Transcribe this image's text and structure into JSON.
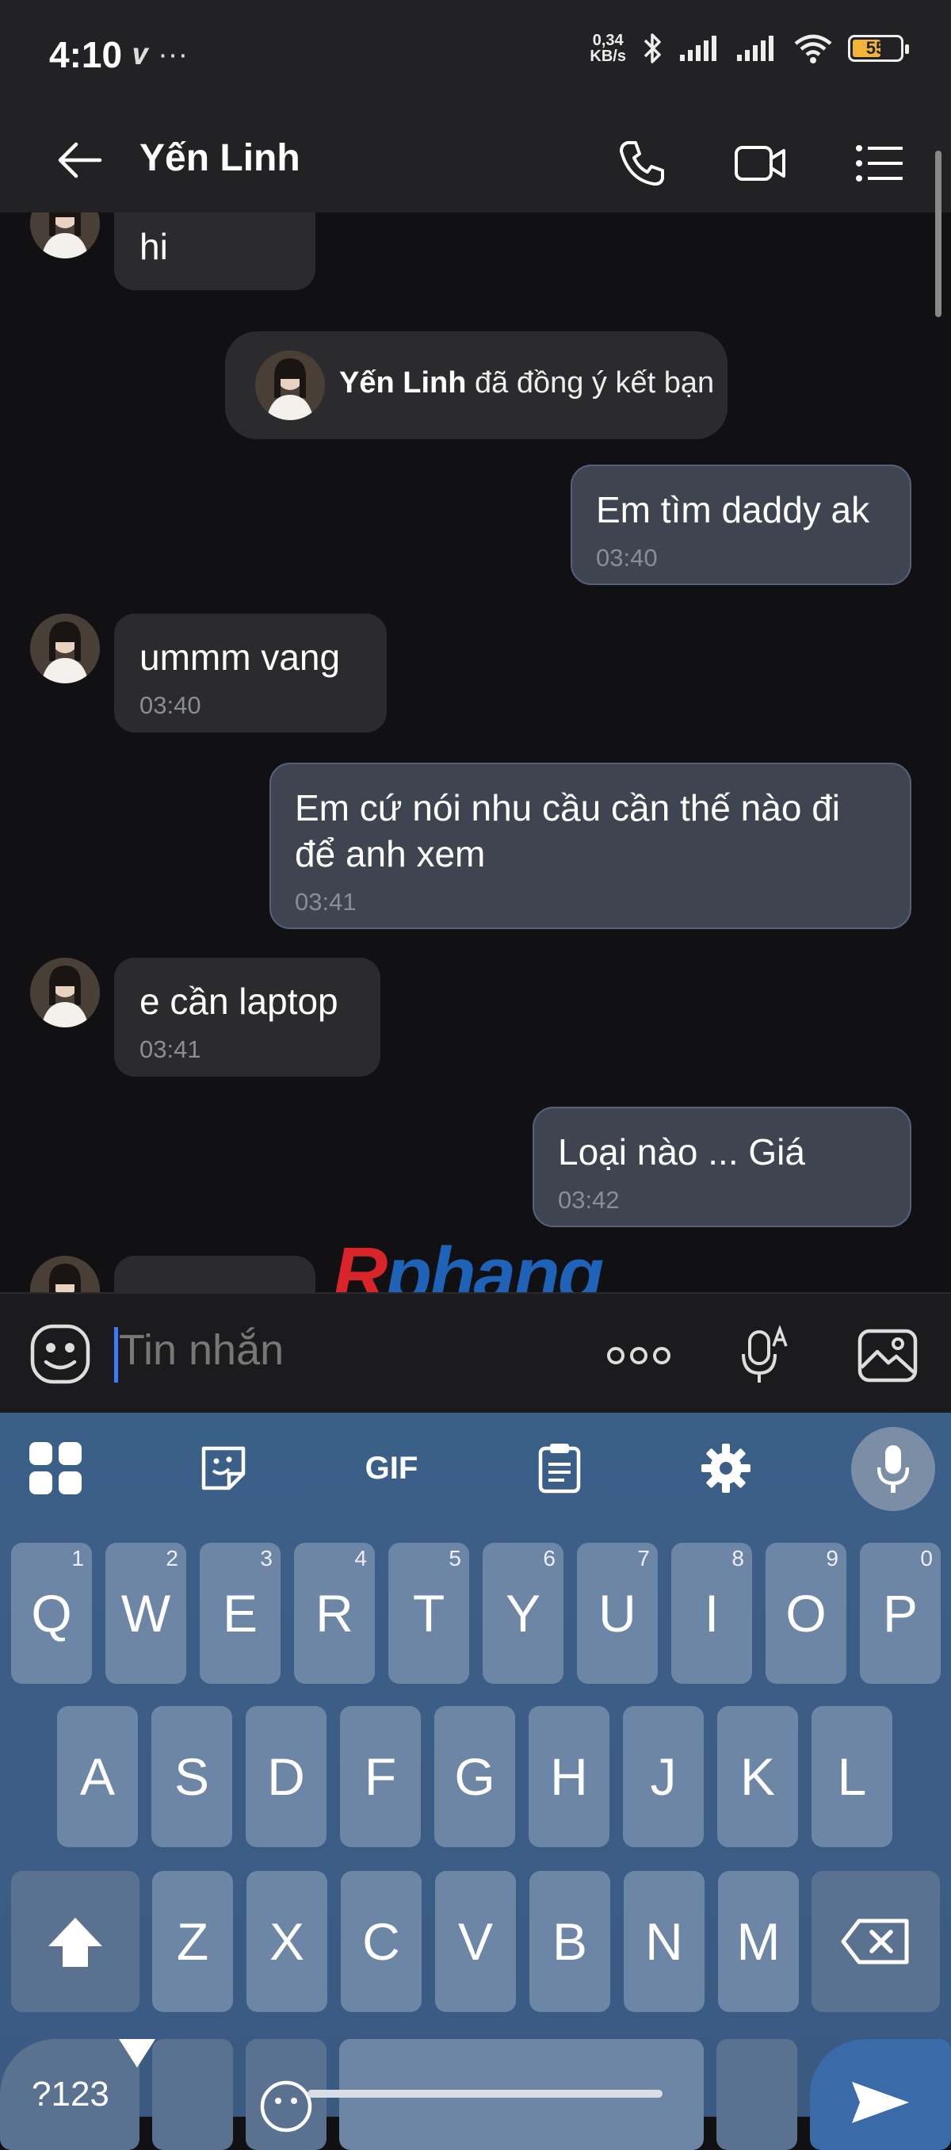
{
  "status_bar": {
    "time": "4:10",
    "net_speed_value": "0,34",
    "net_speed_unit": "KB/s",
    "battery": "55",
    "left_icons": "𝒗 ···"
  },
  "header": {
    "title": "Yến Linh"
  },
  "messages": {
    "msg1": {
      "text": "hi"
    },
    "system": {
      "name": "Yến Linh",
      "action": " đã đồng ý kết bạn"
    },
    "msg2": {
      "text": "Em tìm daddy ak",
      "time": "03:40"
    },
    "msg3": {
      "text": "ummm vang",
      "time": "03:40"
    },
    "msg4": {
      "line1": "Em cứ nói nhu cầu cần thế nào đi",
      "line2": "để anh xem",
      "time": "03:41"
    },
    "msg5": {
      "text": "e cần laptop",
      "time": "03:41"
    },
    "msg6": {
      "text": "Loại nào ... Giá",
      "time": "03:42"
    }
  },
  "watermark": {
    "part1": "R",
    "part2": "phang"
  },
  "input": {
    "placeholder": "Tin nhắn"
  },
  "keyboard": {
    "gif_label": "GIF",
    "row1": [
      {
        "k": "Q",
        "h": "1"
      },
      {
        "k": "W",
        "h": "2"
      },
      {
        "k": "E",
        "h": "3"
      },
      {
        "k": "R",
        "h": "4"
      },
      {
        "k": "T",
        "h": "5"
      },
      {
        "k": "Y",
        "h": "6"
      },
      {
        "k": "U",
        "h": "7"
      },
      {
        "k": "I",
        "h": "8"
      },
      {
        "k": "O",
        "h": "9"
      },
      {
        "k": "P",
        "h": "0"
      }
    ],
    "row2": [
      "A",
      "S",
      "D",
      "F",
      "G",
      "H",
      "J",
      "K",
      "L"
    ],
    "row3": [
      "Z",
      "X",
      "C",
      "V",
      "B",
      "N",
      "M"
    ],
    "symbols_key": "?123"
  },
  "colors": {
    "accent_caret": "#3a7bfd",
    "outgoing_bubble": "#3e4551",
    "incoming_bubble": "#2b2b2e",
    "keyboard_bg": "#3c5d86"
  }
}
